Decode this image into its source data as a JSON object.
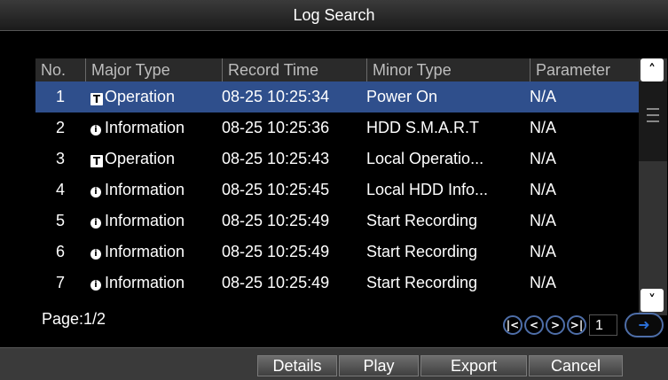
{
  "window": {
    "title": "Log Search"
  },
  "table": {
    "headers": {
      "no": "No.",
      "major": "Major Type",
      "time": "Record Time",
      "minor": "Minor Type",
      "param": "Parameter"
    },
    "rows": [
      {
        "no": "1",
        "major_icon": "operation-icon",
        "major": "Operation",
        "time": "08-25 10:25:34",
        "minor": "Power On",
        "param": "N/A",
        "selected": true
      },
      {
        "no": "2",
        "major_icon": "information-icon",
        "major": "Information",
        "time": "08-25 10:25:36",
        "minor": "HDD S.M.A.R.T",
        "param": "N/A"
      },
      {
        "no": "3",
        "major_icon": "operation-icon",
        "major": "Operation",
        "time": "08-25 10:25:43",
        "minor": "Local Operatio...",
        "param": "N/A"
      },
      {
        "no": "4",
        "major_icon": "information-icon",
        "major": "Information",
        "time": "08-25 10:25:45",
        "minor": "Local HDD Info...",
        "param": "N/A"
      },
      {
        "no": "5",
        "major_icon": "information-icon",
        "major": "Information",
        "time": "08-25 10:25:49",
        "minor": "Start Recording",
        "param": "N/A"
      },
      {
        "no": "6",
        "major_icon": "information-icon",
        "major": "Information",
        "time": "08-25 10:25:49",
        "minor": "Start Recording",
        "param": "N/A"
      },
      {
        "no": "7",
        "major_icon": "information-icon",
        "major": "Information",
        "time": "08-25 10:25:49",
        "minor": "Start Recording",
        "param": "N/A"
      }
    ]
  },
  "pagination": {
    "page_label": "Page:1/2",
    "page_input": "1"
  },
  "footer": {
    "details": "Details",
    "play": "Play",
    "export": "Export",
    "cancel": "Cancel"
  },
  "colors": {
    "selected_row": "#2f4f8c",
    "accent": "#4e6ea8"
  }
}
